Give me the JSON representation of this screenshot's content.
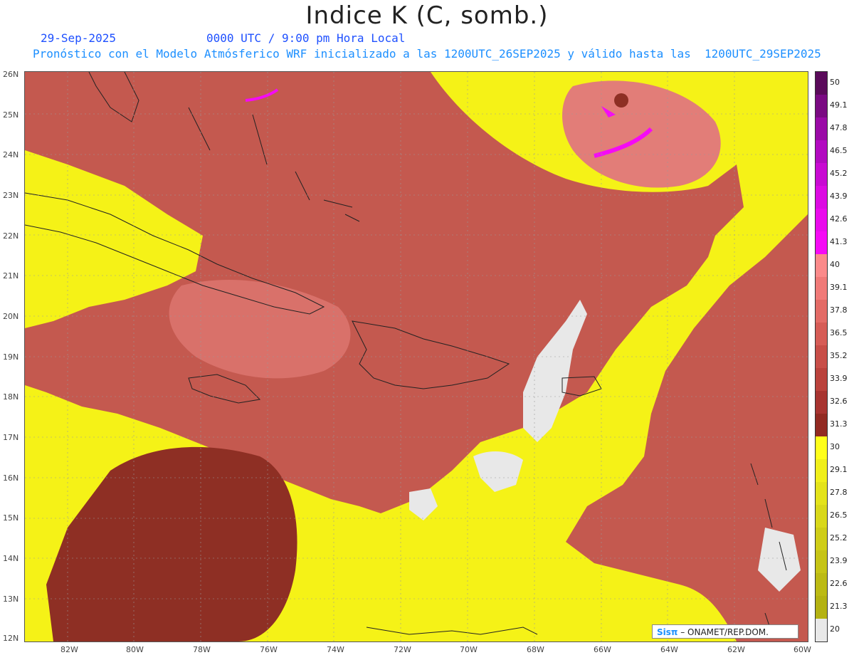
{
  "header": {
    "title": "Indice K (C, somb.)",
    "date": "29-Sep-2025",
    "time": "0000 UTC / 9:00 pm Hora Local",
    "model_line": "Pronóstico con el Modelo Atmósferico WRF inicializado a las 1200UTC_26SEP2025 y válido hasta las  1200UTC_29SEP2025"
  },
  "map": {
    "lat_labels": [
      "26N",
      "25N",
      "24N",
      "23N",
      "22N",
      "21N",
      "20N",
      "19N",
      "18N",
      "17N",
      "16N",
      "15N",
      "14N",
      "13N",
      "12N"
    ],
    "lon_labels": [
      "82W",
      "80W",
      "78W",
      "76W",
      "74W",
      "72W",
      "70W",
      "68W",
      "66W",
      "64W",
      "62W",
      "60W"
    ],
    "lat_range": [
      12,
      26
    ],
    "lon_range": [
      -83.5,
      -60
    ],
    "grid": true
  },
  "colorbar": {
    "labels": [
      "50",
      "49.1",
      "47.8",
      "46.5",
      "45.2",
      "43.9",
      "42.6",
      "41.3",
      "40",
      "39.1",
      "37.8",
      "36.5",
      "35.2",
      "33.9",
      "32.6",
      "31.3",
      "30",
      "29.1",
      "27.8",
      "26.5",
      "25.2",
      "23.9",
      "22.6",
      "21.3",
      "20"
    ],
    "colors": [
      "#5a0a5a",
      "#7a0a82",
      "#9a0aa6",
      "#b20ac0",
      "#c80ad2",
      "#dc0ae2",
      "#ea0aec",
      "#f50af5",
      "#fb8a8a",
      "#f07a78",
      "#e36b66",
      "#d65c56",
      "#c84e48",
      "#bb423c",
      "#a83430",
      "#922a22",
      "#ffff1a",
      "#f0ef1a",
      "#e4e31a",
      "#d9d81a",
      "#cfcd18",
      "#c6c416",
      "#bcba14",
      "#b4b212",
      "#e8e8e8"
    ]
  },
  "credit": {
    "logo": "Sisπ",
    "org": "– ONAMET/REP.DOM."
  }
}
